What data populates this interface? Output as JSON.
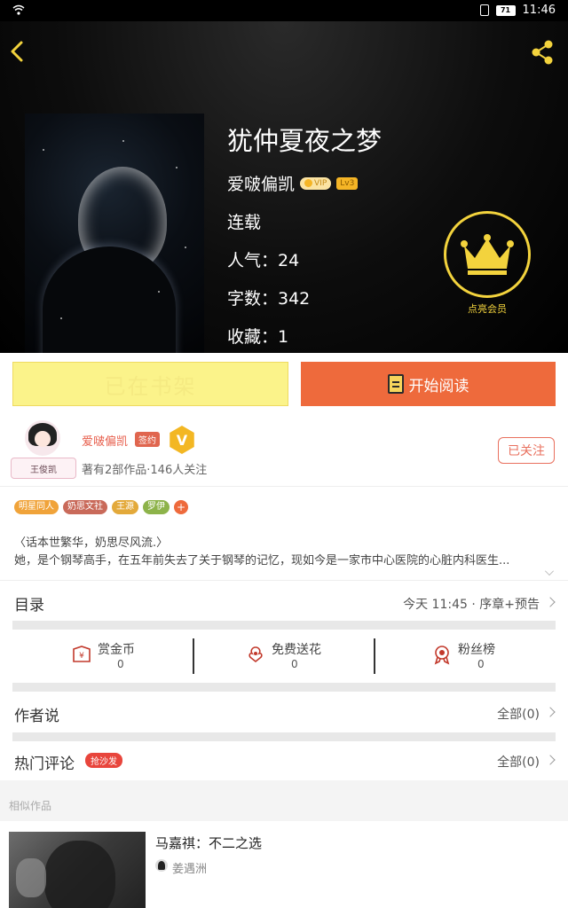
{
  "status_bar": {
    "battery": "71",
    "time": "11:46"
  },
  "book": {
    "title": "犹仲夏夜之梦",
    "author": "爱啵偏凯",
    "vip_label": "VIP",
    "level": "Lv3",
    "status": "连载",
    "popularity": "人气：24",
    "word_count": "字数：342",
    "favorites": "收藏：1"
  },
  "member": {
    "label": "点亮会员"
  },
  "actions": {
    "shelf_label": "已在书架",
    "read_label": "开始阅读"
  },
  "author_card": {
    "avatar_tag": "王俊凯",
    "name": "爱啵偏凯",
    "sign_badge": "签约",
    "v_badge": "V",
    "works": "著有2部作品·146人关注",
    "follow_label": "已关注"
  },
  "tags": [
    {
      "label": "明星同人",
      "color": "#f0a33a"
    },
    {
      "label": "奶思文社",
      "color": "#c96a5a"
    },
    {
      "label": "王源",
      "color": "#e3a93a"
    },
    {
      "label": "罗伊",
      "color": "#8db34a"
    }
  ],
  "tag_more": "+",
  "description": {
    "line1": "〈话本世繁华，奶思尽风流.〉",
    "line2": "她，是个钢琴高手，在五年前失去了关于钢琴的记忆，现如今是一家市中心医院的心脏内科医生..."
  },
  "catalog": {
    "label": "目录",
    "info": "今天 11:45 · 序章+预告"
  },
  "stats": [
    {
      "label": "赏金币",
      "value": "0",
      "icon": "reward-coin-icon"
    },
    {
      "label": "免费送花",
      "value": "0",
      "icon": "flower-icon"
    },
    {
      "label": "粉丝榜",
      "value": "0",
      "icon": "ranking-medal-icon"
    }
  ],
  "author_says": {
    "label": "作者说",
    "right": "全部(0)"
  },
  "hot_comments": {
    "label": "热门评论",
    "badge": "抢沙发",
    "right": "全部(0)"
  },
  "similar": {
    "section_label": "相似作品",
    "items": [
      {
        "title": "马嘉祺：不二之选",
        "author": "姜遇洲"
      }
    ]
  },
  "colors": {
    "accent": "#ee6a3c",
    "shelf_yellow": "#fbf38a",
    "gold": "#f3d33d"
  }
}
